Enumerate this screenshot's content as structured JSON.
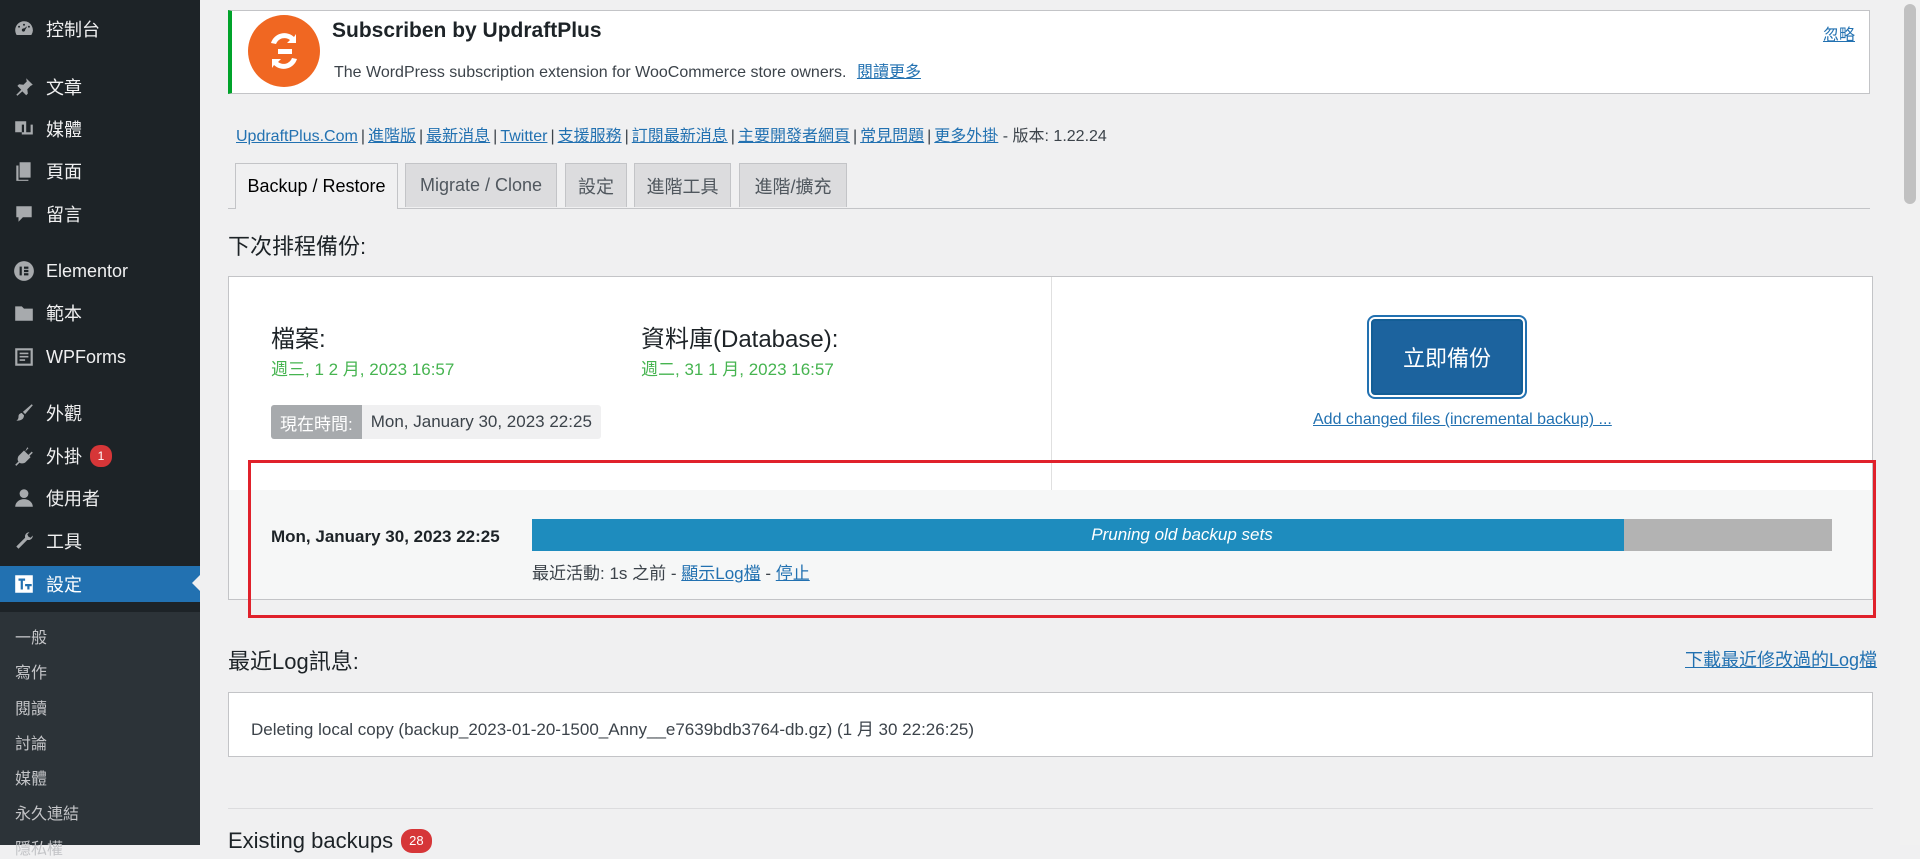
{
  "sidebar": {
    "menu": [
      {
        "key": "dashboard",
        "label": "控制台",
        "icon": "dashboard-icon"
      },
      {
        "key": "posts",
        "label": "文章",
        "icon": "pin-icon"
      },
      {
        "key": "media",
        "label": "媒體",
        "icon": "media-icon"
      },
      {
        "key": "pages",
        "label": "頁面",
        "icon": "pages-icon"
      },
      {
        "key": "comments",
        "label": "留言",
        "icon": "comment-icon"
      },
      {
        "key": "elementor",
        "label": "Elementor",
        "icon": "elementor-icon"
      },
      {
        "key": "templates",
        "label": "範本",
        "icon": "folder-icon"
      },
      {
        "key": "wpforms",
        "label": "WPForms",
        "icon": "wpforms-icon"
      },
      {
        "key": "appearance",
        "label": "外觀",
        "icon": "brush-icon"
      },
      {
        "key": "plugins",
        "label": "外掛",
        "icon": "plugin-icon",
        "badge": "1"
      },
      {
        "key": "users",
        "label": "使用者",
        "icon": "user-icon"
      },
      {
        "key": "tools",
        "label": "工具",
        "icon": "wrench-icon"
      },
      {
        "key": "settings",
        "label": "設定",
        "icon": "settings-icon",
        "active": true
      }
    ],
    "submenu": [
      "一般",
      "寫作",
      "閱讀",
      "討論",
      "媒體",
      "永久連結",
      "隱私權"
    ]
  },
  "notice": {
    "title": "Subscriben by UpdraftPlus",
    "description": "The WordPress subscription extension for WooCommerce store owners.",
    "read_more": "閱讀更多",
    "dismiss": "忽略",
    "logo_color": "#f06722"
  },
  "links": {
    "items": [
      "UpdraftPlus.Com",
      "進階版",
      "最新消息",
      "Twitter",
      "支援服務",
      "訂閱最新消息",
      "主要開發者網頁",
      "常見問題",
      "更多外掛"
    ],
    "version": "- 版本: 1.22.24"
  },
  "tabs": [
    {
      "label": "Backup / Restore",
      "active": true
    },
    {
      "label": "Migrate / Clone"
    },
    {
      "label": "設定"
    },
    {
      "label": "進階工具"
    },
    {
      "label": "進階/擴充"
    }
  ],
  "schedule": {
    "heading": "下次排程備份:",
    "files_label": "檔案:",
    "files_time": "週三, 1 2 月, 2023 16:57",
    "db_label": "資料庫(Database):",
    "db_time": "週二, 31 1 月, 2023 16:57",
    "now_label": "現在時間:",
    "now_value": "Mon, January 30, 2023 22:25",
    "backup_button": "立即備份",
    "incremental_link": "Add changed files (incremental backup) ..."
  },
  "job": {
    "time": "Mon, January 30, 2023 22:25",
    "status": "Pruning old backup sets",
    "progress_percent": 84,
    "activity_prefix": "最近活動: 1s 之前 -",
    "show_log": "顯示Log檔",
    "stop": "停止"
  },
  "log": {
    "heading": "最近Log訊息:",
    "download": "下載最近修改過的Log檔",
    "message": "Deleting local copy (backup_2023-01-20-1500_Anny__e7639bdb3764-db.gz) (1 月 30 22:26:25)"
  },
  "existing": {
    "heading": "Existing backups",
    "count": "28"
  },
  "colors": {
    "sidebar": "#1d2327",
    "accent": "#2271b1",
    "success": "#46b450",
    "progress": "#1e8cbe",
    "highlight": "#e0212b"
  }
}
